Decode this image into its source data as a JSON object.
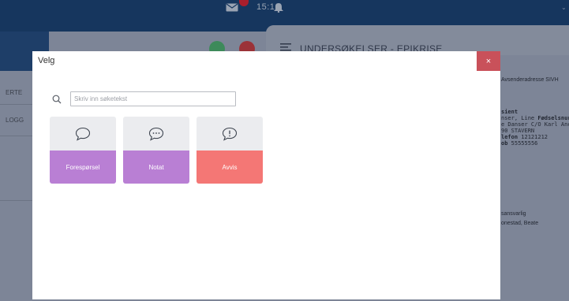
{
  "topbar": {
    "time": "15:16"
  },
  "sidebar": {
    "items": [
      "ERTE",
      "LOGG"
    ]
  },
  "right_panel": {
    "title": "UNDERSØKELSER - EPIKRISE",
    "sender_label": "Avsenderadresse SIVH",
    "patient_heading": "sient",
    "patient_lines": [
      {
        "pre": "nser, Line ",
        "bold": "Fødselsnur"
      },
      {
        "pre": "e Danser C/O Karl Anc",
        "bold": ""
      },
      {
        "pre": "90 STAVERN",
        "bold": ""
      },
      {
        "pre": "",
        "bold": "lefon",
        "post": " 12121212"
      },
      {
        "pre": "",
        "bold": "ob",
        "post": " 55555556"
      }
    ],
    "responsible_label": "sansvarlig",
    "responsible_name": "onestad, Beate"
  },
  "modal": {
    "title": "Velg",
    "close_icon": "×",
    "search": {
      "placeholder": "Skriv inn søketekst",
      "value": ""
    },
    "cards": [
      {
        "label": "Forespørsel",
        "icon": "chat-bubble-icon",
        "color": "#b97fd4"
      },
      {
        "label": "Notat",
        "icon": "chat-dots-icon",
        "color": "#b97fd4"
      },
      {
        "label": "Avvis",
        "icon": "chat-exclamation-icon",
        "color": "#f47775"
      }
    ]
  }
}
